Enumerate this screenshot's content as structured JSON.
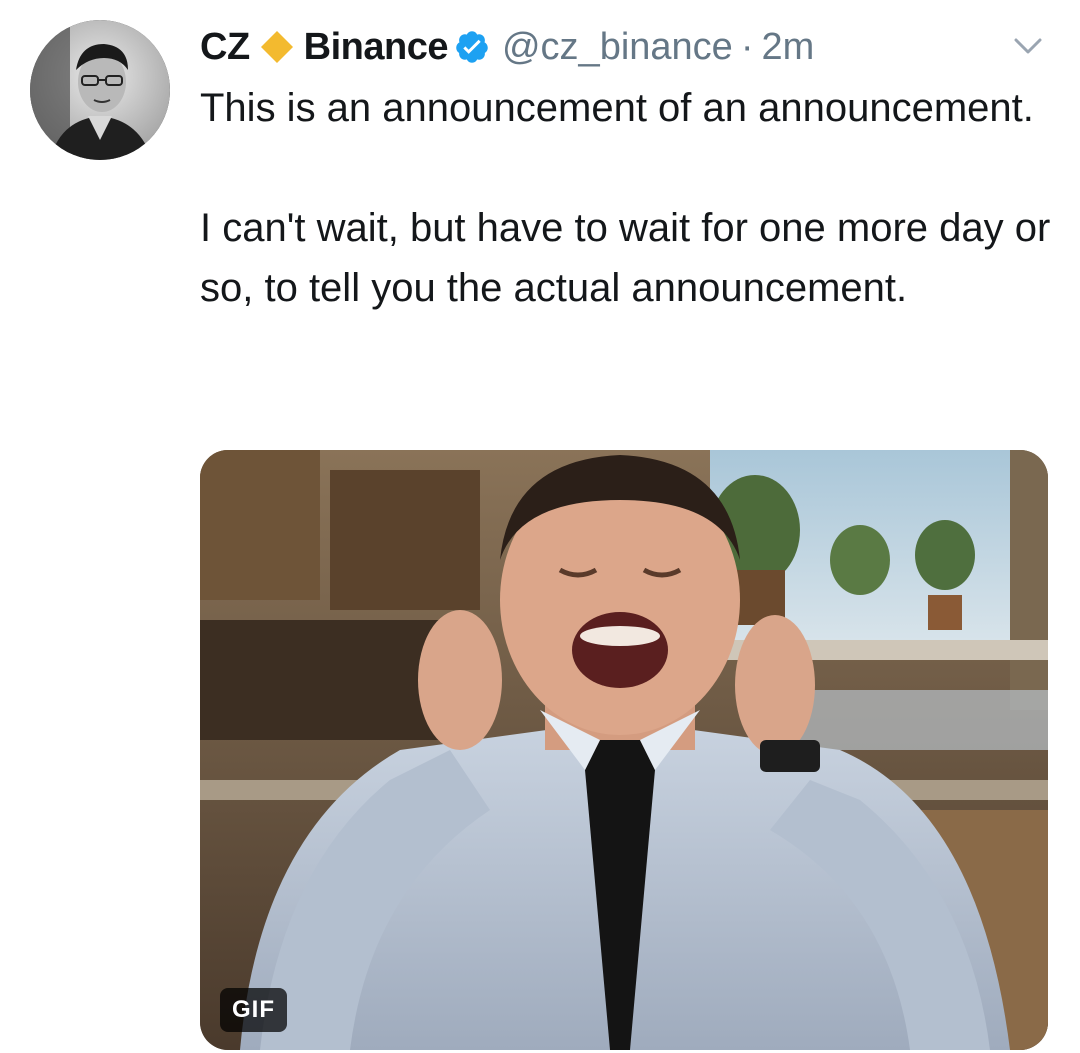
{
  "tweet": {
    "display_name": "CZ",
    "account_name": "Binance",
    "handle": "@cz_binance",
    "separator": "·",
    "timestamp": "2m",
    "paragraphs": [
      "This is an announcement of an announcement.",
      "I can't wait, but have to wait for one more day or so, to tell you the actual announcement."
    ],
    "media_badge": "GIF"
  },
  "icons": {
    "diamond": "binance-diamond-icon",
    "verified": "verified-badge-icon",
    "chevron": "chevron-down-icon"
  },
  "colors": {
    "diamond": "#F3BA2F",
    "verified": "#1DA1F2",
    "secondary_text": "#657786",
    "primary_text": "#14171A"
  }
}
